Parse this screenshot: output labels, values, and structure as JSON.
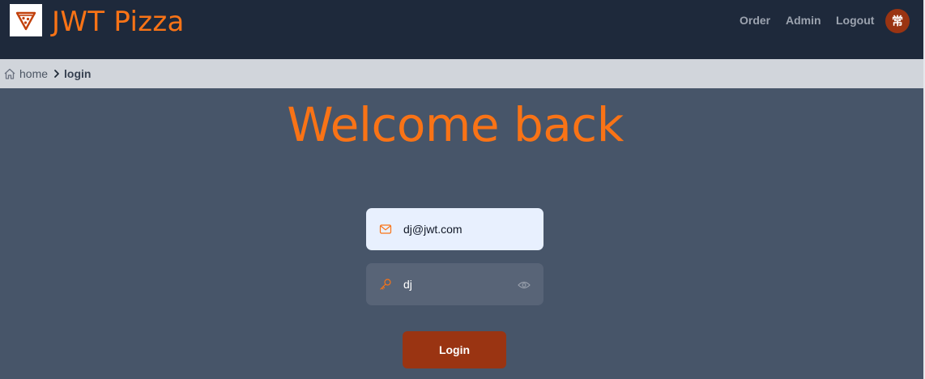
{
  "header": {
    "brand": "JWT Pizza",
    "nav": {
      "order": "Order",
      "admin": "Admin",
      "logout": "Logout"
    },
    "avatar_initial": "常",
    "logo_icon": "pizza-slice-icon"
  },
  "breadcrumb": {
    "home": "home",
    "current": "login",
    "home_icon": "home-icon",
    "separator_icon": "chevron-right-icon"
  },
  "main": {
    "title": "Welcome back"
  },
  "form": {
    "email": {
      "value": "dj@jwt.com",
      "icon": "mail-icon"
    },
    "password": {
      "value": "dj",
      "icon": "key-icon",
      "toggle_icon": "eye-icon"
    },
    "submit_label": "Login"
  },
  "colors": {
    "accent": "#f97316",
    "button": "#9a3412",
    "header_bg": "#1e293b",
    "page_bg": "#475569",
    "breadcrumb_bg": "#d1d5db"
  }
}
